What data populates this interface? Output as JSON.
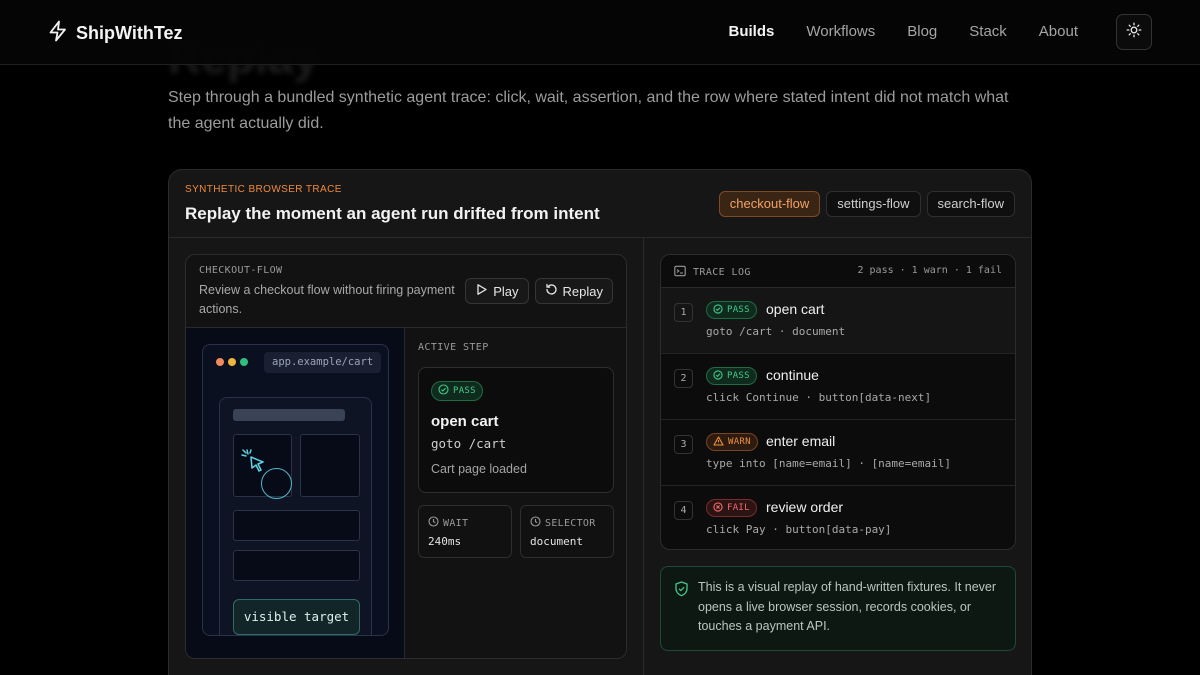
{
  "header": {
    "brand": "ShipWithTez",
    "nav": [
      "Builds",
      "Workflows",
      "Blog",
      "Stack",
      "About"
    ],
    "active_nav": "Builds"
  },
  "page": {
    "title_partial": "Replay",
    "intro": "Step through a bundled synthetic agent trace: click, wait, assertion, and the row where stated intent did not match what the agent actually did."
  },
  "card": {
    "eyebrow": "SYNTHETIC BROWSER TRACE",
    "title": "Replay the moment an agent run drifted from intent",
    "chips": [
      {
        "label": "checkout-flow",
        "active": true
      },
      {
        "label": "settings-flow",
        "active": false
      },
      {
        "label": "search-flow",
        "active": false
      }
    ]
  },
  "flow": {
    "eyebrow": "CHECKOUT-FLOW",
    "description": "Review a checkout flow without firing payment actions.",
    "play_label": "Play",
    "replay_label": "Replay",
    "url": "app.example/cart",
    "target_label": "visible target",
    "active_label": "ACTIVE STEP",
    "active_step": {
      "status": "PASS",
      "name": "open cart",
      "command": "goto /cart",
      "note": "Cart page loaded"
    },
    "wait_label": "WAIT",
    "wait_value": "240ms",
    "selector_label": "SELECTOR",
    "selector_value": "document"
  },
  "trace": {
    "title": "TRACE LOG",
    "summary": "2 pass · 1 warn · 1 fail",
    "rows": [
      {
        "num": "1",
        "status": "PASS",
        "name": "open cart",
        "cmd": "goto /cart · document"
      },
      {
        "num": "2",
        "status": "PASS",
        "name": "continue",
        "cmd": "click Continue · button[data-next]"
      },
      {
        "num": "3",
        "status": "WARN",
        "name": "enter email",
        "cmd": "type into [name=email] · [name=email]"
      },
      {
        "num": "4",
        "status": "FAIL",
        "name": "review order",
        "cmd": "click Pay · button[data-pay]"
      }
    ]
  },
  "notice": "This is a visual replay of hand-written fixtures. It never opens a live browser session, records cookies, or touches a payment API.",
  "colors": {
    "accent": "#f08a3c",
    "pass": "#43c987",
    "warn": "#f0913f",
    "fail": "#f06a6a",
    "window_dots": [
      "#f28a5c",
      "#f0b43c",
      "#2fc07f"
    ]
  },
  "icons": {
    "brand": "lightning-bolt-icon",
    "theme": "sun-icon",
    "play": "play-icon",
    "replay": "rotate-icon",
    "trace": "terminal-icon",
    "notice": "shield-check-icon"
  }
}
